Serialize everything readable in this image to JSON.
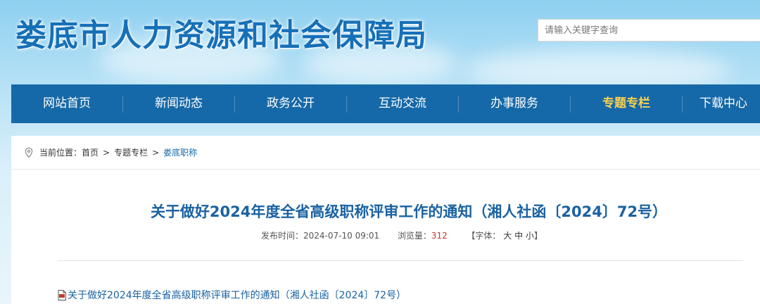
{
  "header": {
    "site_title": "娄底市人力资源和社会保障局",
    "search_placeholder": "请输入关键字查询"
  },
  "nav": {
    "items": [
      {
        "label": "网站首页"
      },
      {
        "label": "新闻动态"
      },
      {
        "label": "政务公开"
      },
      {
        "label": "互动交流"
      },
      {
        "label": "办事服务"
      },
      {
        "label": "专题专栏",
        "active": true
      },
      {
        "label": "下载中心"
      }
    ],
    "active_color": "#ffd24a"
  },
  "breadcrumb": {
    "icon": "location-pin-icon",
    "prefix": "当前位置：",
    "items": [
      "首页",
      "专题专栏",
      "娄底职称"
    ],
    "separator": ">"
  },
  "article": {
    "title": "关于做好2024年度全省高级职称评审工作的通知（湘人社函〔2024〕72号）",
    "publish_label": "发布时间：",
    "publish_time": "2024-07-10 09:01",
    "views_label": "浏览量：",
    "views": "312",
    "font_size_open": "【字体：",
    "font_sizes": [
      "大",
      "中",
      "小"
    ],
    "font_size_close": "】",
    "attachment": {
      "icon": "pdf-file-icon",
      "label": "关于做好2024年度全省高级职称评审工作的通知（湘人社函〔2024〕72号）"
    }
  },
  "colors": {
    "brand_blue": "#1669a8",
    "title_blue": "#1a62a2",
    "views_red": "#c0392b"
  }
}
